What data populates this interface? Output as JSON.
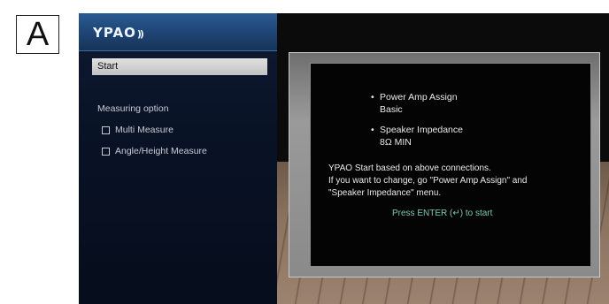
{
  "figure_label": "A",
  "app": {
    "logo": "YPAO",
    "logo_mark": "))"
  },
  "sidebar": {
    "start_label": "Start",
    "measuring_option_title": "Measuring option",
    "options": [
      {
        "label": "Multi Measure",
        "checked": false
      },
      {
        "label": "Angle/Height Measure",
        "checked": false
      }
    ]
  },
  "monitor": {
    "bullets": [
      {
        "title": "Power Amp Assign",
        "value": "Basic"
      },
      {
        "title": "Speaker Impedance",
        "value": "8Ω MIN"
      }
    ],
    "message_lines": [
      "YPAO Start based on above connections.",
      "If you want to change, go \"Power Amp Assign\" and",
      "\"Speaker Impedance\" menu."
    ],
    "enter_prompt": "Press ENTER (↵) to start"
  },
  "colors": {
    "sidebar_bg": "#091326",
    "logo_bar": "#1f4676",
    "highlight": "#cfcfcf",
    "prompt": "#78c7b7"
  }
}
